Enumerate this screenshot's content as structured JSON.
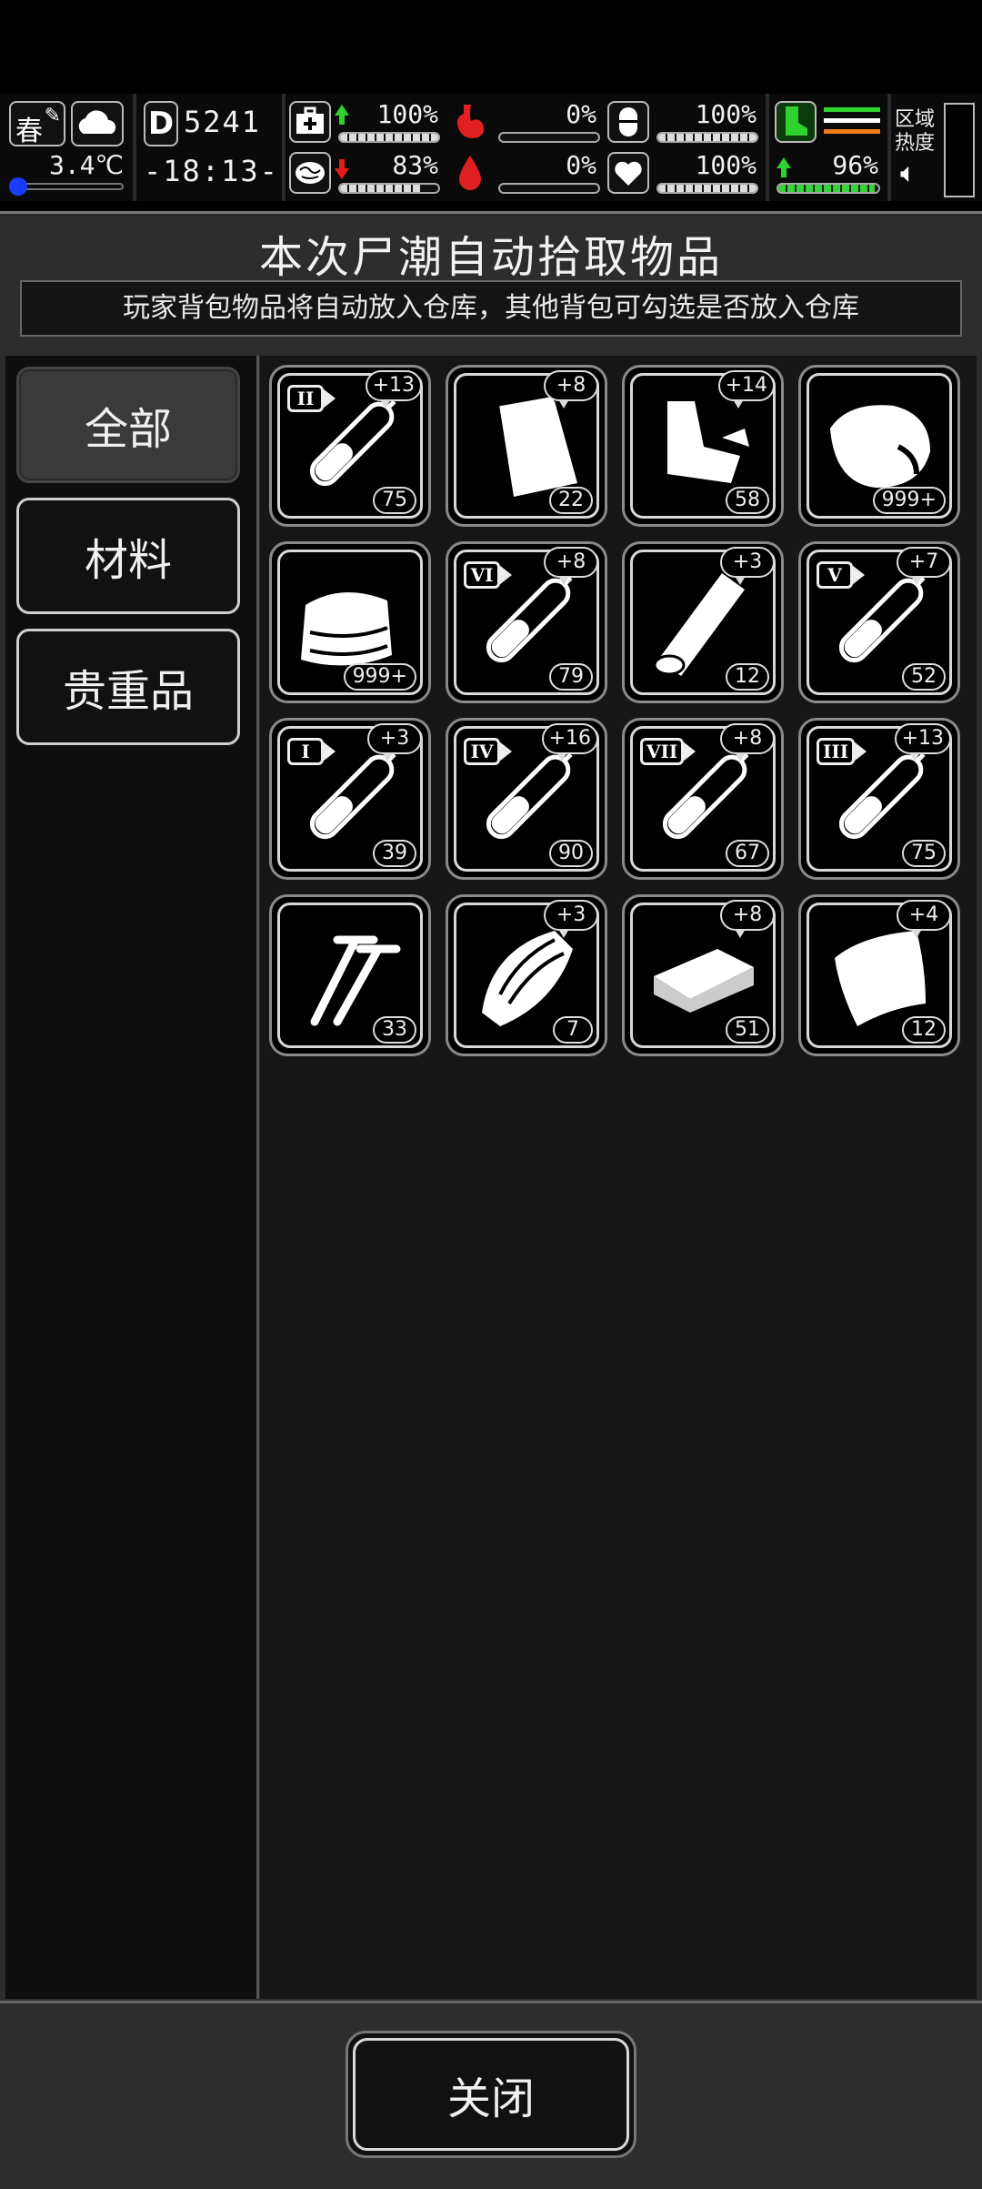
{
  "hud": {
    "season": "春",
    "temperature": "3.4℃",
    "day": "5241",
    "time": "-18:13-",
    "health": "100%",
    "hunger": "0%",
    "stamina": "100%",
    "sanity": "83%",
    "thirst": "0%",
    "mood": "100%",
    "speed": "96%",
    "zone_label": "区域热度",
    "icons": [
      "weather-cloud-icon",
      "medkit-icon",
      "stomach-icon",
      "pill-icon",
      "brain-icon",
      "blood-drop-icon",
      "heart-icon",
      "boot-icon",
      "speaker-icon"
    ]
  },
  "dialog": {
    "title": "本次尸潮自动拾取物品",
    "subtitle": "玩家背包物品将自动放入仓库，其他背包可勾选是否放入仓库",
    "tabs": [
      "全部",
      "材料",
      "贵重品"
    ],
    "close": "关闭"
  },
  "items": [
    {
      "icon": "test-tube-icon",
      "roman": "II",
      "bonus": "+13",
      "count": "75"
    },
    {
      "icon": "plastic-bag-icon",
      "roman": "",
      "bonus": "+8",
      "count": "22"
    },
    {
      "icon": "scrap-metal-icon",
      "roman": "",
      "bonus": "+14",
      "count": "58"
    },
    {
      "icon": "raw-meat-icon",
      "roman": "",
      "bonus": "",
      "count": "999+"
    },
    {
      "icon": "cloth-icon",
      "roman": "",
      "bonus": "",
      "count": "999+"
    },
    {
      "icon": "test-tube-icon",
      "roman": "VI",
      "bonus": "+8",
      "count": "79"
    },
    {
      "icon": "wood-log-icon",
      "roman": "",
      "bonus": "+3",
      "count": "12"
    },
    {
      "icon": "test-tube-icon",
      "roman": "V",
      "bonus": "+7",
      "count": "52"
    },
    {
      "icon": "test-tube-icon",
      "roman": "I",
      "bonus": "+3",
      "count": "39"
    },
    {
      "icon": "test-tube-icon",
      "roman": "IV",
      "bonus": "+16",
      "count": "90"
    },
    {
      "icon": "test-tube-icon",
      "roman": "VII",
      "bonus": "+8",
      "count": "67"
    },
    {
      "icon": "test-tube-icon",
      "roman": "III",
      "bonus": "+13",
      "count": "75"
    },
    {
      "icon": "nails-icon",
      "roman": "",
      "bonus": "",
      "count": "33"
    },
    {
      "icon": "wood-planks-icon",
      "roman": "",
      "bonus": "+3",
      "count": "7"
    },
    {
      "icon": "ingot-icon",
      "roman": "",
      "bonus": "+8",
      "count": "51"
    },
    {
      "icon": "leather-icon",
      "roman": "",
      "bonus": "+4",
      "count": "12"
    }
  ]
}
